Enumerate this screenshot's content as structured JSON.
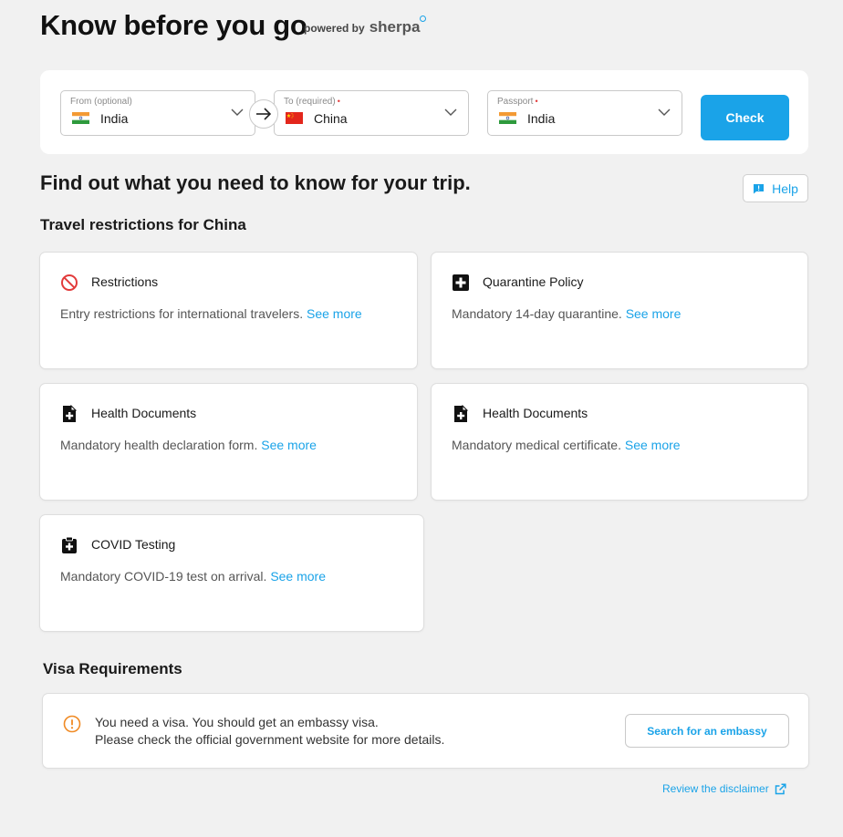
{
  "header": {
    "title": "Know before you go",
    "powered_by": "powered by",
    "brand": "sherpa"
  },
  "search": {
    "from": {
      "label": "From (optional)",
      "value": "India",
      "flag": "india-flag",
      "required": false
    },
    "to": {
      "label": "To (required)",
      "value": "China",
      "flag": "china-flag",
      "required": true
    },
    "passport": {
      "label": "Passport",
      "value": "India",
      "flag": "india-flag",
      "required": true
    },
    "required_mark": "•",
    "swap_icon": "arrow-right-icon",
    "check_label": "Check"
  },
  "main": {
    "subtitle": "Find out what you need to know for your trip.",
    "help_label": "Help",
    "restrictions_title": "Travel restrictions for China"
  },
  "cards": [
    {
      "icon": "no-entry-icon",
      "title": "Restrictions",
      "description": "Entry restrictions for international travelers.",
      "link": "See more"
    },
    {
      "icon": "medical-cross-icon",
      "title": "Quarantine Policy",
      "description": "Mandatory 14-day quarantine.",
      "link": "See more"
    },
    {
      "icon": "health-document-icon",
      "title": "Health Documents",
      "description": "Mandatory health declaration form.",
      "link": "See more"
    },
    {
      "icon": "health-document-icon",
      "title": "Health Documents",
      "description": "Mandatory medical certificate.",
      "link": "See more"
    },
    {
      "icon": "clipboard-medical-icon",
      "title": "COVID Testing",
      "description": "Mandatory COVID-19 test on arrival.",
      "link": "See more"
    }
  ],
  "visa": {
    "title": "Visa Requirements",
    "icon": "warning-circle-icon",
    "line1": "You need a visa. You should get an embassy visa.",
    "line2": "Please check the official government website for more details.",
    "button_label": "Search for an embassy"
  },
  "footer": {
    "disclaimer_label": "Review the disclaimer",
    "disclaimer_icon": "external-link-icon"
  },
  "colors": {
    "accent": "#1aa3e8",
    "background": "#f1f1f1",
    "danger": "#e23b3b",
    "warning": "#f08a24"
  }
}
